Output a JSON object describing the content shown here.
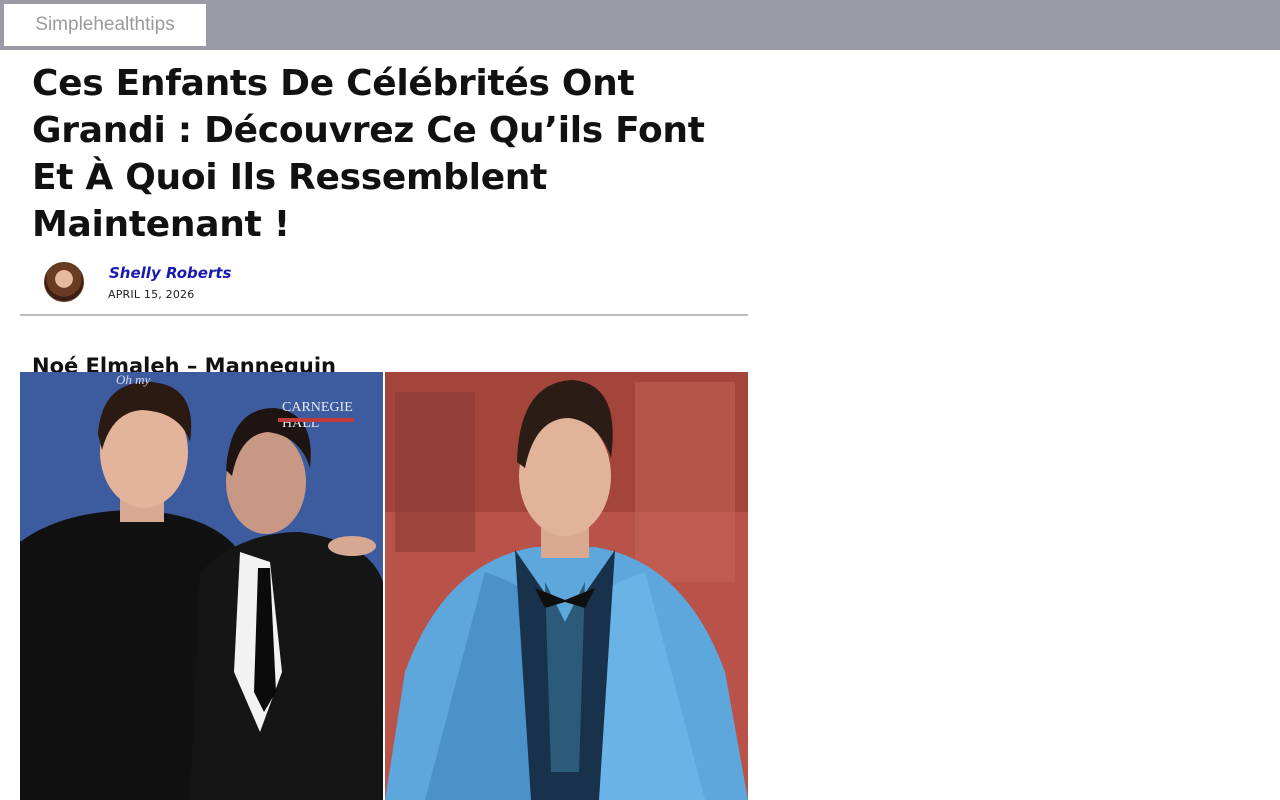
{
  "site": {
    "logo_text": "Simplehealthtips"
  },
  "article": {
    "title": "Ces Enfants De Célébrités Ont Grandi : Découvrez Ce Qu’ils Font Et À Quoi Ils Ressemblent Maintenant !",
    "author": "Shelly Roberts",
    "date": "APRIL 15, 2026",
    "section_heading": "Noé Elmaleh – Mannequin",
    "photo_left_sign_text": "CARNEGIE HALL",
    "photo_left_top_text": "Oh my"
  },
  "colors": {
    "topbar": "#9a99a6",
    "author_link": "#1a1ab0"
  }
}
